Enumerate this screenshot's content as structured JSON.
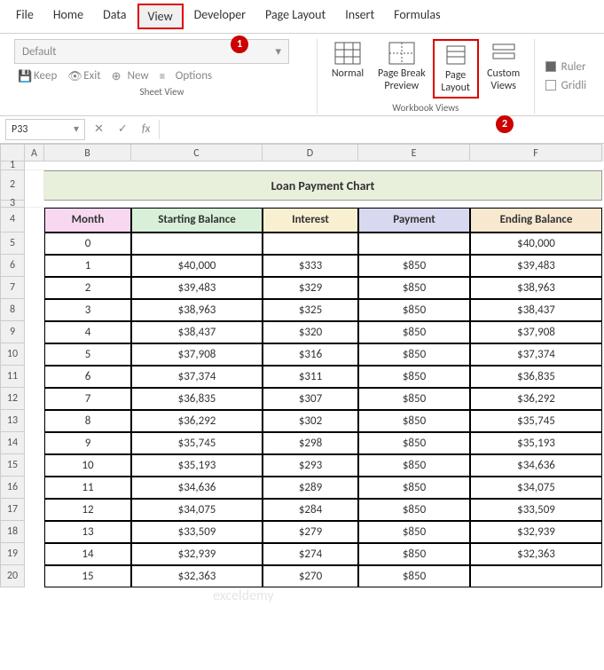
{
  "menu": [
    "File",
    "Home",
    "Data",
    "View",
    "Developer",
    "Page Layout",
    "Insert",
    "Formulas"
  ],
  "active_menu": 3,
  "ribbon": {
    "sheet_view": {
      "dropdown": "Default",
      "buttons": [
        "Keep",
        "Exit",
        "New",
        "Options"
      ],
      "label": "Sheet View"
    },
    "workbook_views": {
      "items": [
        {
          "label": "Normal"
        },
        {
          "label": "Page Break\nPreview"
        },
        {
          "label": "Page\nLayout"
        },
        {
          "label": "Custom\nViews"
        }
      ],
      "label": "Workbook Views",
      "highlighted": 2
    },
    "show": {
      "ruler": "Ruler",
      "gridlines": "Gridli"
    }
  },
  "annotations": {
    "1": "1",
    "2": "2"
  },
  "name_box": "P33",
  "fx_label": "fx",
  "columns": [
    "A",
    "B",
    "C",
    "D",
    "E",
    "F"
  ],
  "row_numbers": [
    1,
    2,
    3,
    4,
    5,
    6,
    7,
    8,
    9,
    10,
    11,
    12,
    13,
    14,
    15,
    16,
    17,
    18,
    19,
    20
  ],
  "title": "Loan Payment Chart",
  "headers": [
    "Month",
    "Starting Balance",
    "Interest",
    "Payment",
    "Ending Balance"
  ],
  "rows": [
    {
      "m": "0",
      "sb": "",
      "i": "",
      "p": "",
      "eb": "$40,000"
    },
    {
      "m": "1",
      "sb": "$40,000",
      "i": "$333",
      "p": "$850",
      "eb": "$39,483"
    },
    {
      "m": "2",
      "sb": "$39,483",
      "i": "$329",
      "p": "$850",
      "eb": "$38,963"
    },
    {
      "m": "3",
      "sb": "$38,963",
      "i": "$325",
      "p": "$850",
      "eb": "$38,437"
    },
    {
      "m": "4",
      "sb": "$38,437",
      "i": "$320",
      "p": "$850",
      "eb": "$37,908"
    },
    {
      "m": "5",
      "sb": "$37,908",
      "i": "$316",
      "p": "$850",
      "eb": "$37,374"
    },
    {
      "m": "6",
      "sb": "$37,374",
      "i": "$311",
      "p": "$850",
      "eb": "$36,835"
    },
    {
      "m": "7",
      "sb": "$36,835",
      "i": "$307",
      "p": "$850",
      "eb": "$36,292"
    },
    {
      "m": "8",
      "sb": "$36,292",
      "i": "$302",
      "p": "$850",
      "eb": "$35,745"
    },
    {
      "m": "9",
      "sb": "$35,745",
      "i": "$298",
      "p": "$850",
      "eb": "$35,193"
    },
    {
      "m": "10",
      "sb": "$35,193",
      "i": "$293",
      "p": "$850",
      "eb": "$34,636"
    },
    {
      "m": "11",
      "sb": "$34,636",
      "i": "$289",
      "p": "$850",
      "eb": "$34,075"
    },
    {
      "m": "12",
      "sb": "$34,075",
      "i": "$284",
      "p": "$850",
      "eb": "$33,509"
    },
    {
      "m": "13",
      "sb": "$33,509",
      "i": "$279",
      "p": "$850",
      "eb": "$32,939"
    },
    {
      "m": "14",
      "sb": "$32,939",
      "i": "$274",
      "p": "$850",
      "eb": "$32,363"
    },
    {
      "m": "15",
      "sb": "$32,363",
      "i": "$270",
      "p": "$850",
      "eb": ""
    }
  ],
  "watermark": "exceldemy"
}
